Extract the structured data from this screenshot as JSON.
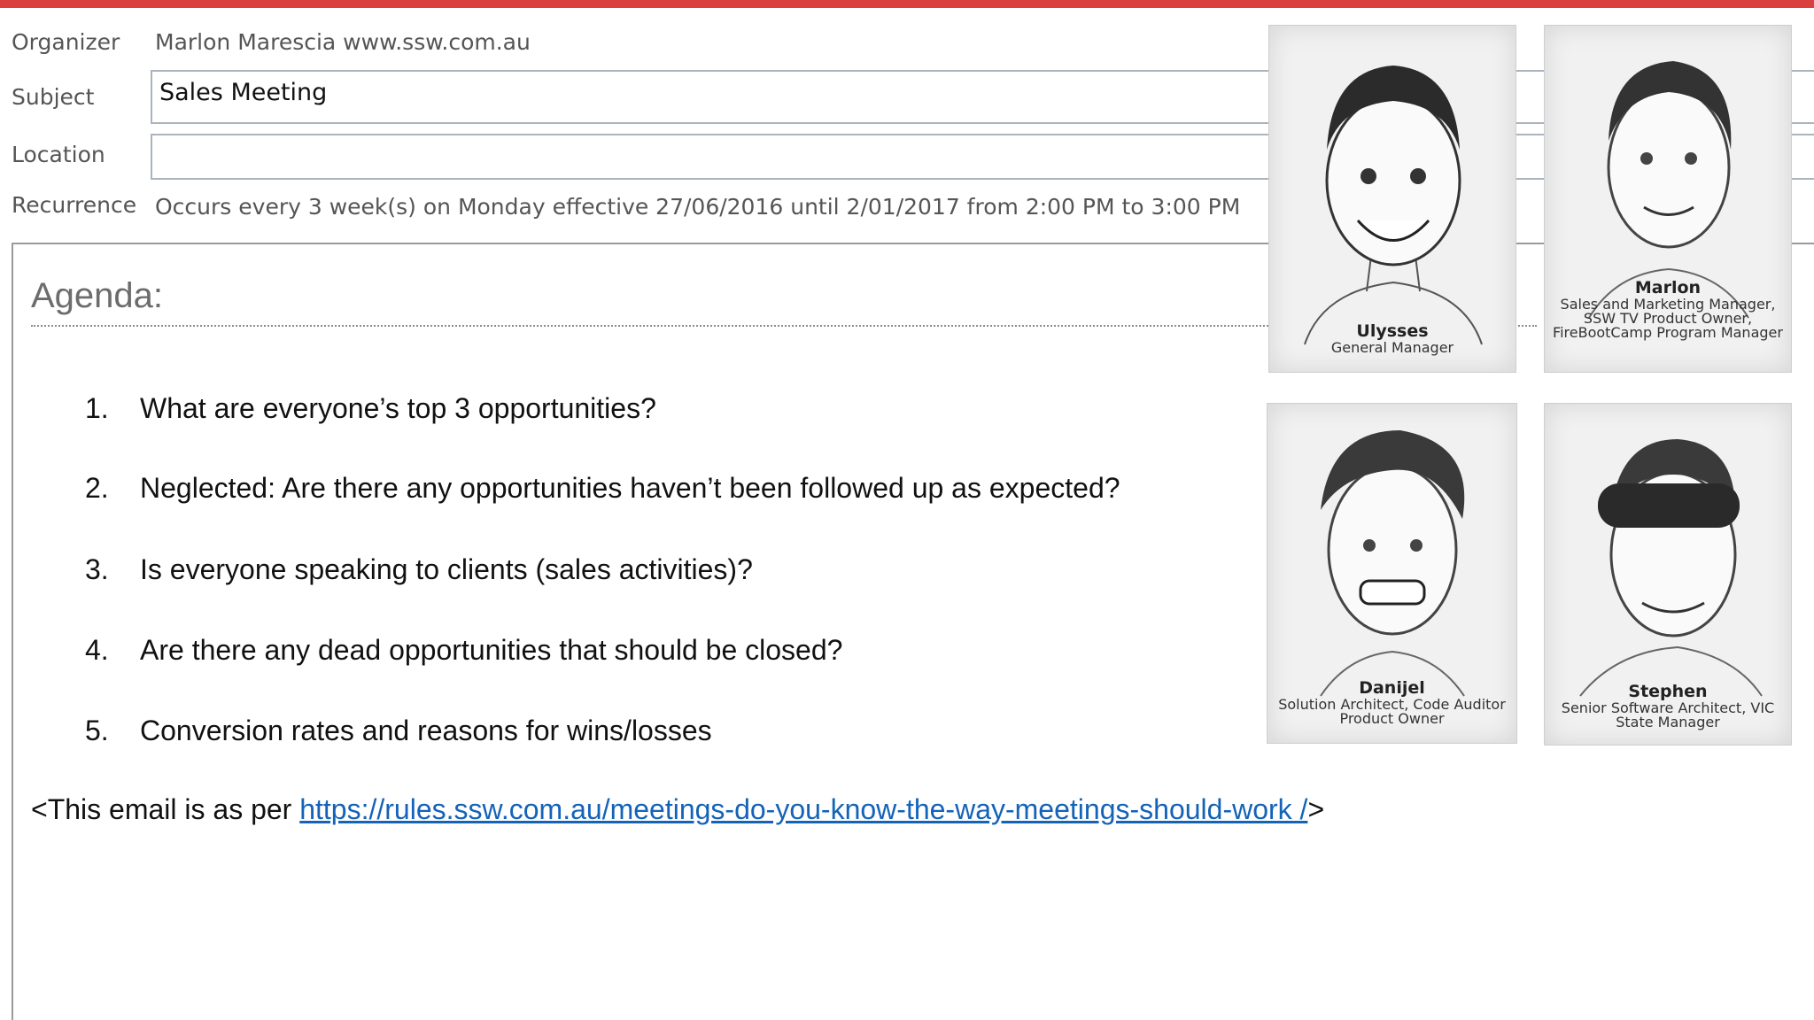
{
  "meeting": {
    "organizer_label": "Organizer",
    "organizer_value": "Marlon Marescia www.ssw.com.au",
    "subject_label": "Subject",
    "subject_value": "Sales Meeting",
    "location_label": "Location",
    "location_value": "",
    "recurrence_label": "Recurrence",
    "recurrence_value": "Occurs every 3 week(s) on Monday effective 27/06/2016 until 2/01/2017 from 2:00 PM to 3:00 PM"
  },
  "body": {
    "heading": "Agenda:",
    "items": [
      {
        "num": "1.",
        "text": "What are everyone’s top 3 opportunities?"
      },
      {
        "num": "2.",
        "text": "Neglected: Are there any opportunities haven’t been followed up as expected?"
      },
      {
        "num": "3.",
        "text": "Is everyone speaking to clients (sales activities)?"
      },
      {
        "num": "4.",
        "text": "Are there any dead opportunities that should be closed?"
      },
      {
        "num": "5.",
        "text": "Conversion rates and reasons for wins/losses"
      }
    ],
    "footer_prefix": "<This email is as per ",
    "footer_link": "https://rules.ssw.com.au/meetings-do-you-know-the-way-meetings-should-work /",
    "footer_suffix": ">"
  },
  "people": [
    {
      "name": "Ulysses",
      "role": "General Manager"
    },
    {
      "name": "Marlon",
      "role": "Sales and Marketing Manager, SSW TV Product Owner, FireBootCamp Program Manager"
    },
    {
      "name": "Danijel",
      "role": "Solution Architect, Code Auditor Product Owner"
    },
    {
      "name": "Stephen",
      "role": "Senior Software Architect, VIC State Manager"
    }
  ],
  "colors": {
    "accent_bar": "#d9413f",
    "link": "#1463b8"
  }
}
